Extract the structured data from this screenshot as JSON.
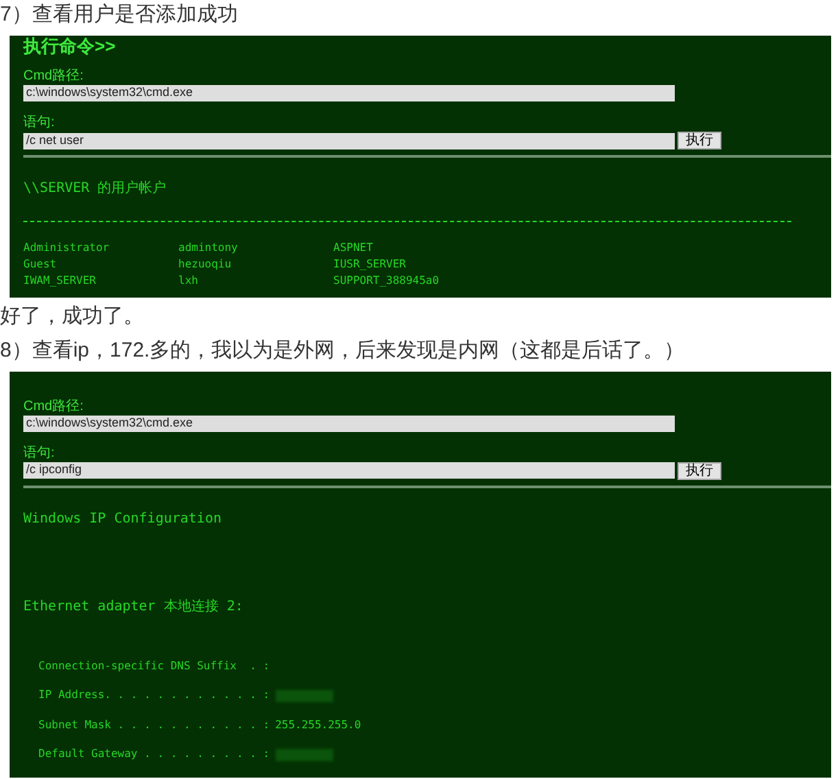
{
  "blocks": [
    {
      "kind": "paragraph",
      "text": "7）查看用户是否添加成功"
    },
    {
      "kind": "shell",
      "title": "执行命令>>",
      "cmd_path_label": "Cmd路径:",
      "cmd_path": "c:\\windows\\system32\\cmd.exe",
      "statement_label": "语句:",
      "statement": "/c net user",
      "run_button": "执行",
      "output": [
        {
          "kind": "line",
          "text": "\\\\SERVER 的用户帐户"
        },
        {
          "kind": "rule"
        },
        {
          "kind": "columns",
          "cells": [
            "Administrator",
            "admintony",
            "ASPNET"
          ]
        },
        {
          "kind": "columns",
          "cells": [
            "Guest",
            "hezuoqiu",
            "IUSR_SERVER"
          ]
        },
        {
          "kind": "columns",
          "cells": [
            "IWAM_SERVER",
            "lxh",
            "SUPPORT_388945a0"
          ]
        }
      ]
    },
    {
      "kind": "paragraph",
      "text": "好了，成功了。"
    },
    {
      "kind": "paragraph",
      "text": "8）查看ip，172.多的，我以为是外网，后来发现是内网（这都是后话了。）"
    },
    {
      "kind": "shell",
      "cmd_path_label": "Cmd路径:",
      "cmd_path": "c:\\windows\\system32\\cmd.exe",
      "statement_label": "语句:",
      "statement": "/c ipconfig",
      "run_button": "执行",
      "output": [
        {
          "kind": "line",
          "text": "Windows IP Configuration"
        },
        {
          "kind": "blank"
        },
        {
          "kind": "blank"
        },
        {
          "kind": "line",
          "text": "Ethernet adapter 本地连接 2:"
        },
        {
          "kind": "blank"
        },
        {
          "kind": "field",
          "label": "Connection-specific DNS Suffix  . :",
          "redacted": false
        },
        {
          "kind": "field",
          "label": "IP Address. . . . . . . . . . . . :",
          "redacted": true
        },
        {
          "kind": "field",
          "label": "Subnet Mask . . . . . . . . . . . :",
          "value": "255.255.255.0",
          "redacted": false
        },
        {
          "kind": "field",
          "label": "Default Gateway . . . . . . . . . :",
          "redacted": true
        }
      ]
    }
  ]
}
